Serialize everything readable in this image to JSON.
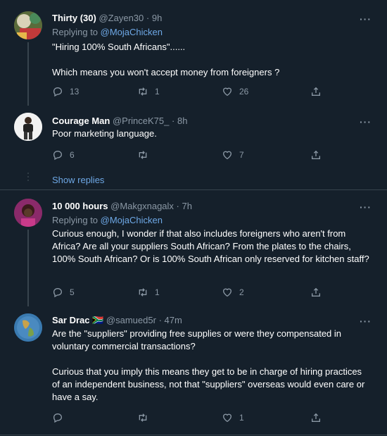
{
  "tweets": [
    {
      "name": "Thirty (30)",
      "handle": "@Zayen30",
      "dot": "·",
      "time": "9h",
      "replying_prefix": "Replying to ",
      "replying_to": "@MojaChicken",
      "text": [
        "\"Hiring 100% South Africans\"......",
        "Which means you won't accept money from foreigners ?"
      ],
      "replies": "13",
      "retweets": "1",
      "likes": "26"
    },
    {
      "name": "Courage Man",
      "handle": "@PrinceK75_",
      "dot": "·",
      "time": "8h",
      "text": [
        "Poor marketing language."
      ],
      "replies": "6",
      "retweets": "",
      "likes": "7"
    },
    {
      "name": "10 000 hours",
      "handle": "@Makgxnagalx",
      "dot": "·",
      "time": "7h",
      "replying_prefix": "Replying to ",
      "replying_to": "@MojaChicken",
      "text": [
        "Curious enough, I wonder if that also includes foreigners who aren't from Africa? Are all your suppliers South African? From the plates to the chairs, 100% South African? Or is 100% South African only reserved for kitchen staff?"
      ],
      "replies": "5",
      "retweets": "1",
      "likes": "2"
    },
    {
      "name": "Sar Drac",
      "flag": "🇿🇦",
      "handle": "@samued5r",
      "dot": "·",
      "time": "47m",
      "text": [
        "Are the \"suppliers\" providing free supplies or were they compensated in voluntary commercial transactions?",
        "Curious that you imply this means they get to be in charge of hiring practices of an independent business, not that \"suppliers\" overseas would even care or have a say."
      ],
      "replies": "",
      "retweets": "",
      "likes": "1"
    }
  ],
  "show_replies": "Show replies",
  "more_glyph": "···",
  "colors": {
    "background": "#15202b",
    "secondary_text": "#8b98a5",
    "link": "#6ea8e6",
    "divider": "#38444d"
  }
}
